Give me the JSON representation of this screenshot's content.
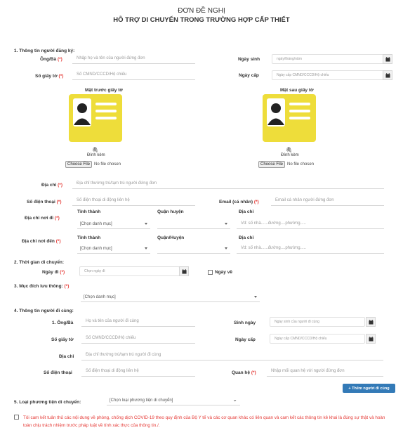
{
  "header": {
    "title": "ĐƠN ĐỀ NGHỊ",
    "subtitle": "HỖ TRỢ DI CHUYỂN TRONG TRƯỜNG HỢP CẤP THIẾT"
  },
  "section1": {
    "title": "1. Thông tin người đăng ký:",
    "name_label": "Ông/Bà",
    "name_placeholder": "Nhập họ và tên của người đứng đơn",
    "dob_label": "Ngày sinh",
    "dob_placeholder": "ngày/tháng/năm",
    "idno_label": "Số giấy tờ",
    "idno_placeholder": "Số CMND/CCCD/Hộ chiếu",
    "issue_label": "Ngày cấp",
    "issue_placeholder": "Ngày cấp CMND/CCCD/Hộ chiếu",
    "front_label": "Mặt trước giấy tờ",
    "back_label": "Mặt sau giấy tờ",
    "attach_label": "Đính kèm",
    "choose_file": "Choose File",
    "no_file": "No file chosen",
    "address_label": "Địa chỉ",
    "address_placeholder": "Địa chỉ thường trú/tạm trú người đứng đơn",
    "phone_label": "Số điện thoại",
    "phone_placeholder": "Số điện thoại di động liên hệ",
    "email_label": "Email (cá nhân)",
    "email_placeholder": "Email cá nhân người đứng đơn",
    "from_label": "Địa chỉ nơi đi",
    "to_label": "Địa chỉ nơi đến",
    "province_label": "Tỉnh thành",
    "district_label": "Quận huyện",
    "district_label2": "Quận/Huyện",
    "street_label": "Địa chỉ",
    "select_default": "[Chọn danh mục]",
    "street_placeholder": "Vd: số nhà......đường....phường....."
  },
  "section2": {
    "title": "2. Thời gian di chuyển:",
    "date_label": "Ngày đi",
    "date_placeholder": "Chọn ngày đi",
    "return_label": "Ngày về"
  },
  "section3": {
    "title": "3. Mục đích lưu thông:",
    "select_default": "[Chọn danh mục]"
  },
  "section4": {
    "title": "4. Thông tin người đi cùng:",
    "name_label": "1. Ông/Bà",
    "name_placeholder": "Họ và tên của người đi cùng",
    "dob_label": "Sinh ngày",
    "dob_placeholder": "Ngày sinh của người đi cùng",
    "idno_label": "Số giấy tờ",
    "idno_placeholder": "Số CMND/CCCD/Hộ chiếu",
    "issue_label": "Ngày cấp",
    "issue_placeholder": "Ngày cấp CMND/CCCD/Hộ chiếu",
    "address_label": "Địa chỉ",
    "address_placeholder": "Địa chỉ thường trú/tạm trú người đi cùng",
    "phone_label": "Số điện thoại",
    "phone_placeholder": "Số điện thoại di động liên hệ",
    "relation_label": "Quan hệ",
    "relation_placeholder": "Nhập mối quan hệ với người đứng đơn",
    "add_button": "+ Thêm người đi cùng"
  },
  "section5": {
    "title": "5. Loại phương tiện di chuyển:",
    "select_default": "[Chọn loại phương tiện di chuyển]"
  },
  "commitment": "Tôi cam kết tuân thủ các nội dung về phòng, chống dịch COVID-19 theo quy định của Bộ Y tế và các cơ quan khác có liên quan và cam kết các thông tin kê khai là đúng sự thật và hoàn toàn chịu trách nhiệm trước pháp luật về tính xác thực của thông tin./.",
  "required_mark": "(*)",
  "colors": {
    "accent": "#337ab7",
    "required": "#e53935",
    "card": "#eedd3a"
  },
  "icons": {
    "calendar": "calendar-icon",
    "paperclip": "paperclip-icon",
    "id_card": "id-card-icon"
  }
}
